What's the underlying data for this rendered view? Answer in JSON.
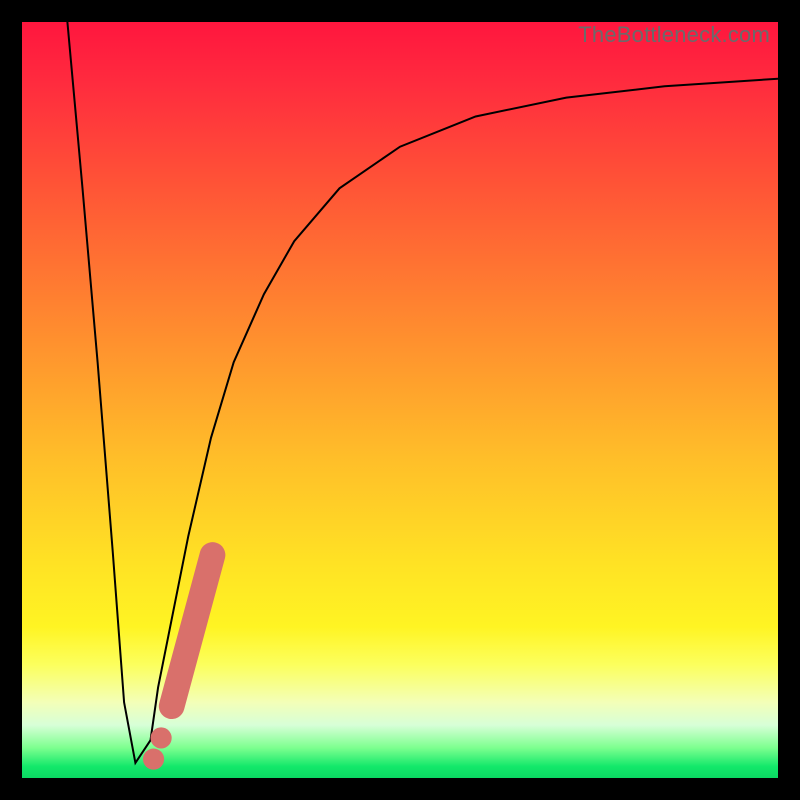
{
  "watermark": "TheBottleneck.com",
  "chart_data": {
    "type": "line",
    "title": "",
    "xlabel": "",
    "ylabel": "",
    "xlim": [
      0,
      100
    ],
    "ylim": [
      0,
      100
    ],
    "grid": false,
    "legend": false,
    "series": [
      {
        "name": "bottleneck-curve",
        "x": [
          6,
          8,
          10,
          12,
          13.5,
          15,
          17,
          18,
          20,
          22,
          25,
          28,
          32,
          36,
          42,
          50,
          60,
          72,
          85,
          100
        ],
        "y": [
          100,
          78,
          55,
          30,
          10,
          2,
          5,
          12,
          22,
          32,
          45,
          55,
          64,
          71,
          78,
          83.5,
          87.5,
          90,
          91.5,
          92.5
        ]
      }
    ],
    "markers": [
      {
        "name": "exclamation-dot-1",
        "shape": "circle",
        "x": 17.4,
        "y": 2.5,
        "r": 1.4,
        "color": "#d9706b"
      },
      {
        "name": "exclamation-dot-2",
        "shape": "circle",
        "x": 18.4,
        "y": 5.3,
        "r": 1.4,
        "color": "#d9706b"
      },
      {
        "name": "exclamation-bar",
        "shape": "capsule",
        "x1": 19.8,
        "y1": 9.5,
        "x2": 25.2,
        "y2": 29.5,
        "width": 3.4,
        "color": "#d9706b"
      }
    ],
    "background": {
      "type": "vertical-gradient",
      "stops": [
        {
          "pos": 0.0,
          "color": "#ff163e"
        },
        {
          "pos": 0.4,
          "color": "#ff8a2f"
        },
        {
          "pos": 0.72,
          "color": "#ffe324"
        },
        {
          "pos": 0.9,
          "color": "#f3ffb8"
        },
        {
          "pos": 0.985,
          "color": "#12e86a"
        }
      ]
    }
  }
}
